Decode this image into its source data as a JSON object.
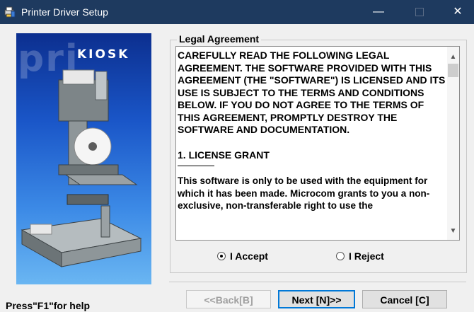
{
  "window": {
    "title": "Printer Driver Setup",
    "minimize_glyph": "—",
    "close_glyph": "✕"
  },
  "banner": {
    "watermark_text": "pri",
    "brand_text": "KIOSK",
    "illustration": "kiosk-printer-illustration"
  },
  "agreement": {
    "group_label": "Legal Agreement",
    "paragraph_1": "CAREFULLY READ THE FOLLOWING LEGAL AGREEMENT. THE SOFTWARE PROVIDED WITH THIS AGREEMENT (THE \"SOFTWARE\") IS LICENSED AND ITS USE IS SUBJECT TO THE TERMS AND CONDITIONS BELOW. IF YOU DO NOT AGREE TO THE TERMS OF THIS AGREEMENT, PROMPTLY DESTROY THE SOFTWARE AND DOCUMENTATION.",
    "heading_1": "1. LICENSE GRANT",
    "paragraph_2": "This software is only to be used with the equipment for which it has been made. Microcom grants to you a non-exclusive, non-transferable right to use the"
  },
  "options": {
    "accept_label": "I Accept",
    "reject_label": "I Reject",
    "selected": "accept"
  },
  "buttons": {
    "back_label": "<<Back[B]",
    "next_label": "Next [N]>>",
    "cancel_label": "Cancel [C]"
  },
  "status": {
    "help_text": "Press\"F1\"for help"
  },
  "colors": {
    "titlebar": "#1e3a5f",
    "focus_border": "#0078d7",
    "banner_top": "#0c2f8f",
    "banner_bottom": "#6ab6f2"
  }
}
